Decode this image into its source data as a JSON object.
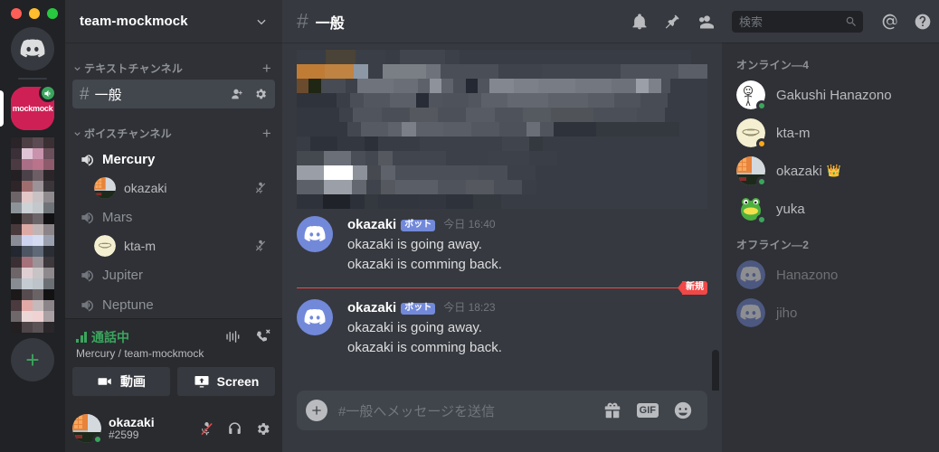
{
  "window": {
    "traffic_lights": [
      "close",
      "minimize",
      "maximize"
    ]
  },
  "server_rail": {
    "home_label": "discord-home",
    "active_server": {
      "name": "mockmock",
      "voice_connected": true
    },
    "add_server_label": "+"
  },
  "sidebar": {
    "guild_name": "team-mockmock",
    "text_category": {
      "label": "テキストチャンネル",
      "add_label": "+"
    },
    "text_channels": [
      {
        "name": "一般",
        "hash": "#",
        "active": true
      }
    ],
    "voice_category": {
      "label": "ボイスチャンネル",
      "add_label": "+"
    },
    "voice_channels": [
      {
        "name": "Mercury",
        "active": true,
        "users": [
          {
            "name": "okazaki",
            "muted": true
          }
        ]
      },
      {
        "name": "Mars",
        "active": false,
        "users": [
          {
            "name": "kta-m",
            "muted": true
          }
        ]
      },
      {
        "name": "Jupiter",
        "active": false,
        "users": []
      },
      {
        "name": "Neptune",
        "active": false,
        "users": []
      }
    ],
    "voice_panel": {
      "status": "通話中",
      "location": "Mercury / team-mockmock",
      "video_button": "動画",
      "screen_button": "Screen"
    },
    "user_panel": {
      "username": "okazaki",
      "discriminator": "#2599",
      "status": "online",
      "mic_muted": true
    }
  },
  "topbar": {
    "hash": "#",
    "channel": "一般",
    "search_placeholder": "検索"
  },
  "messages": {
    "censored_block": true,
    "items": [
      {
        "author": "okazaki",
        "bot_tag": "ボット",
        "day": "今日",
        "time": "16:40",
        "lines": [
          "okazaki is going away.",
          "okazaki is comming back."
        ]
      },
      {
        "author": "okazaki",
        "bot_tag": "ボット",
        "day": "今日",
        "time": "18:23",
        "lines": [
          "okazaki is going away.",
          "okazaki is comming back."
        ]
      }
    ],
    "new_divider_label": "新規"
  },
  "composer": {
    "placeholder": "#一般へメッセージを送信",
    "gif_label": "GIF"
  },
  "members": {
    "online_header": "オンライン—4",
    "online": [
      {
        "name": "Gakushi Hanazono",
        "status": "online",
        "avatar": "stickfigure",
        "crown": false
      },
      {
        "name": "kta-m",
        "status": "idle",
        "avatar": "cream",
        "crown": false
      },
      {
        "name": "okazaki",
        "status": "online",
        "avatar": "rubik",
        "crown": true
      },
      {
        "name": "yuka",
        "status": "online",
        "avatar": "frog",
        "crown": false
      }
    ],
    "offline_header": "オフライン—2",
    "offline": [
      {
        "name": "Hanazono",
        "avatar": "discord"
      },
      {
        "name": "jiho",
        "avatar": "discord"
      }
    ]
  },
  "colors": {
    "rail_bg": "#202225",
    "sidebar_bg": "#2f3136",
    "main_bg": "#36393f",
    "brand_blurple": "#7289da",
    "online_green": "#3ba55d",
    "idle_yellow": "#faa81a",
    "new_red": "#f04747",
    "server_pink": "#cf2055"
  }
}
